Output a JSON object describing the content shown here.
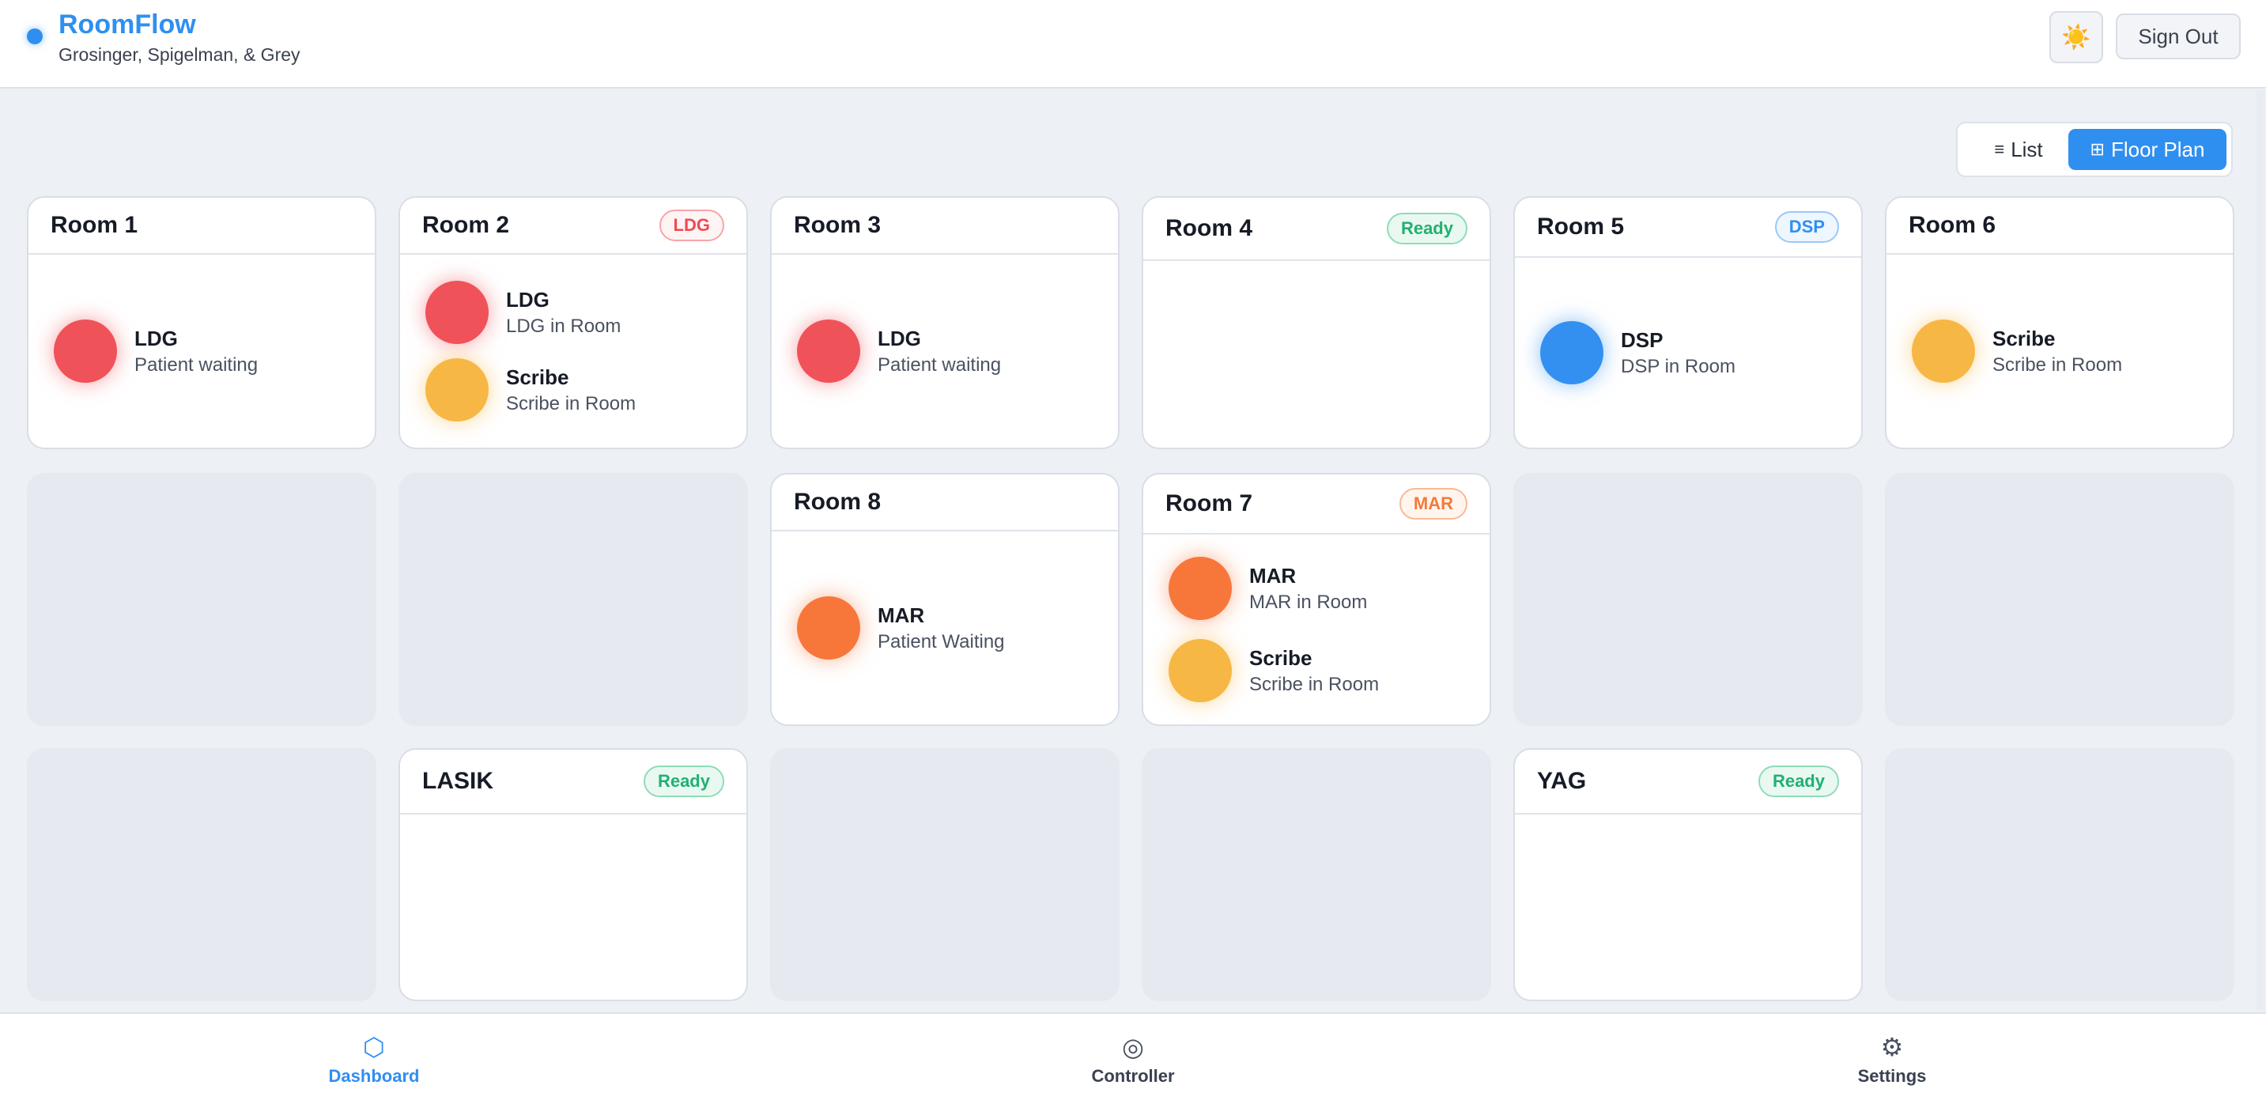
{
  "app": {
    "title": "RoomFlow",
    "subtitle": "Grosinger, Spigelman, & Grey",
    "accent": "#2f8ff0"
  },
  "header": {
    "theme_icon": "sun-icon",
    "theme_glyph": "☀️",
    "sign_out_label": "Sign Out"
  },
  "view_toggle": {
    "list_glyph": "≡",
    "list_label": "List",
    "floor_glyph": "⊞",
    "floor_label": "Floor Plan",
    "selected": "Floor Plan"
  },
  "rooms": {
    "room1": {
      "name": "Room 1",
      "occupants": [
        {
          "name": "LDG",
          "status": "Patient waiting",
          "color": "#f0525a"
        }
      ]
    },
    "room2": {
      "name": "Room 2",
      "badge": "LDG",
      "occupants": [
        {
          "name": "LDG",
          "status": "LDG in Room",
          "color": "#f0525a"
        },
        {
          "name": "Scribe",
          "status": "Scribe in Room",
          "color": "#f7b744"
        }
      ]
    },
    "room3": {
      "name": "Room 3",
      "occupants": [
        {
          "name": "LDG",
          "status": "Patient waiting",
          "color": "#f0525a"
        }
      ]
    },
    "room4": {
      "name": "Room 4",
      "badge": "Ready",
      "occupants": []
    },
    "room5": {
      "name": "Room 5",
      "badge": "DSP",
      "occupants": [
        {
          "name": "DSP",
          "status": "DSP in Room",
          "color": "#3390f0"
        }
      ]
    },
    "room6": {
      "name": "Room 6",
      "occupants": [
        {
          "name": "Scribe",
          "status": "Scribe in Room",
          "color": "#f7b744"
        }
      ]
    },
    "room8": {
      "name": "Room 8",
      "occupants": [
        {
          "name": "MAR",
          "status": "Patient Waiting",
          "color": "#f7773b"
        }
      ]
    },
    "room7": {
      "name": "Room 7",
      "badge": "MAR",
      "occupants": [
        {
          "name": "MAR",
          "status": "MAR in Room",
          "color": "#f7773b"
        },
        {
          "name": "Scribe",
          "status": "Scribe in Room",
          "color": "#f7b744"
        }
      ]
    },
    "lasik": {
      "name": "LASIK",
      "badge": "Ready",
      "occupants": []
    },
    "yag": {
      "name": "YAG",
      "badge": "Ready",
      "occupants": []
    }
  },
  "nav": {
    "dashboard": {
      "icon": "⬡",
      "label": "Dashboard",
      "active": true
    },
    "controller": {
      "icon": "◎",
      "label": "Controller"
    },
    "settings": {
      "icon": "⚙",
      "label": "Settings"
    }
  }
}
